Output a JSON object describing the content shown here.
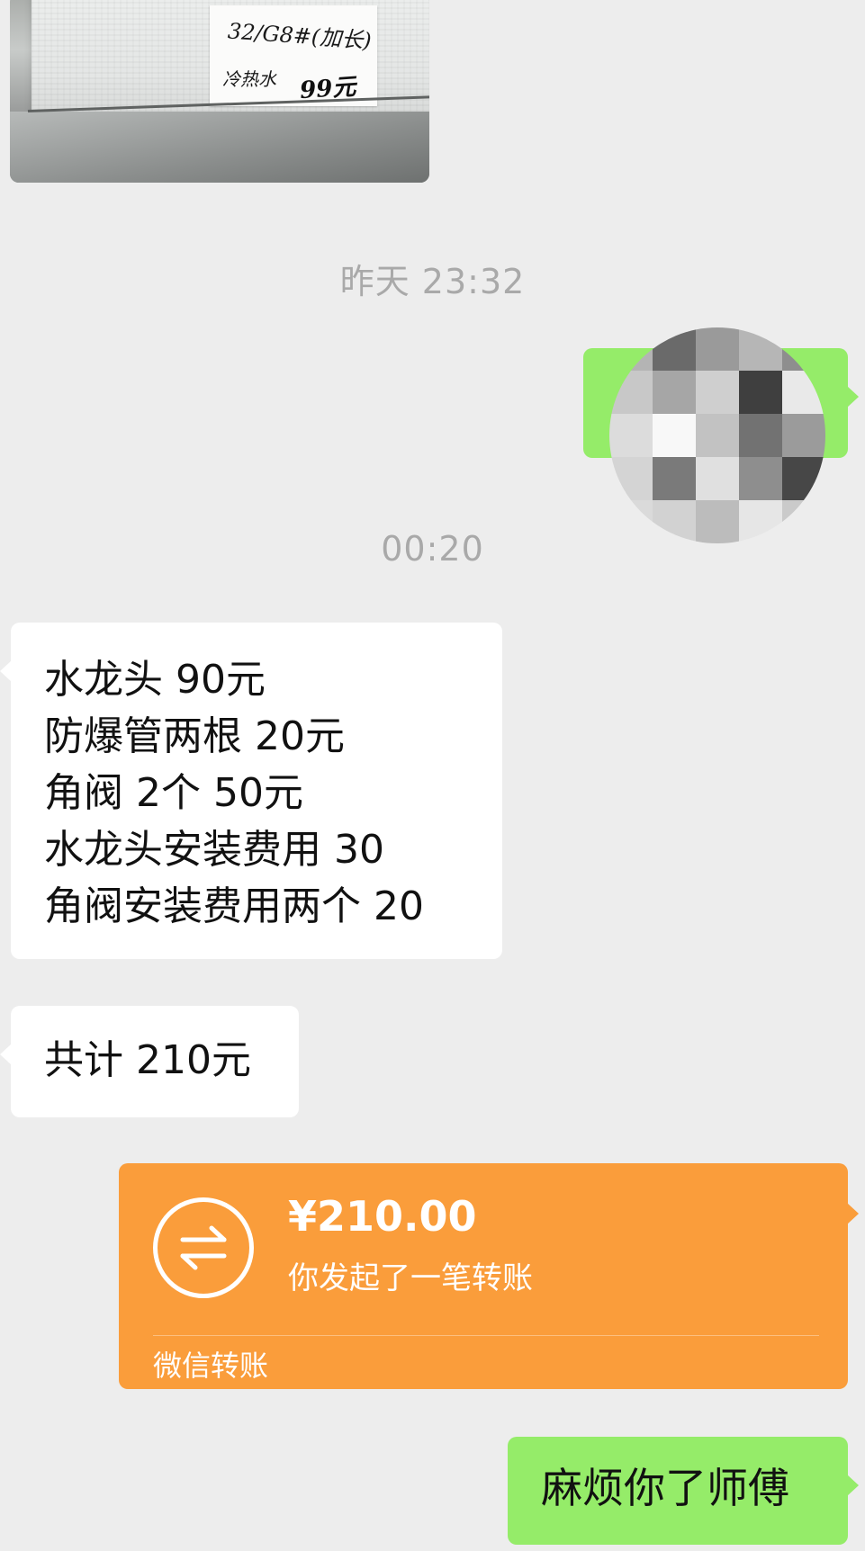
{
  "photo": {
    "label_line1": "32/G8#(加长)",
    "label_line2": "冷热水",
    "label_price": "99元"
  },
  "timestamps": [
    "昨天 23:32",
    "00:20"
  ],
  "messages": {
    "item_list": [
      "水龙头 90元",
      "防爆管两根 20元",
      "角阀 2个 50元",
      "水龙头安装费用 30",
      "角阀安装费用两个 20"
    ],
    "total": "共计 210元",
    "thanks": "麻烦你了师傅"
  },
  "transfer": {
    "amount": "¥210.00",
    "description": "你发起了一笔转账",
    "footer": "微信转账",
    "icon": "transfer-arrows-icon",
    "color": "#fa9d3b"
  },
  "colors": {
    "background": "#ededed",
    "received_bubble": "#ffffff",
    "sent_bubble": "#95ec69",
    "timestamp": "#a9a9a9"
  },
  "avatar": {
    "style": "pixelated-blur",
    "mosaic": [
      [
        "#b4b4b4",
        "#6a6a6a",
        "#9a9a9a",
        "#b6b6b6",
        "#8e8e8e"
      ],
      [
        "#c8c8c8",
        "#a6a6a6",
        "#cfcfcf",
        "#3f3f3f",
        "#e9e9e9"
      ],
      [
        "#dcdcdc",
        "#f8f8f8",
        "#c2c2c2",
        "#727272",
        "#9b9b9b"
      ],
      [
        "#d4d4d4",
        "#7a7a7a",
        "#e0e0e0",
        "#8e8e8e",
        "#474747"
      ],
      [
        "#dadada",
        "#d2d2d2",
        "#bcbcbc",
        "#e6e6e6",
        "#cacaca"
      ]
    ]
  }
}
